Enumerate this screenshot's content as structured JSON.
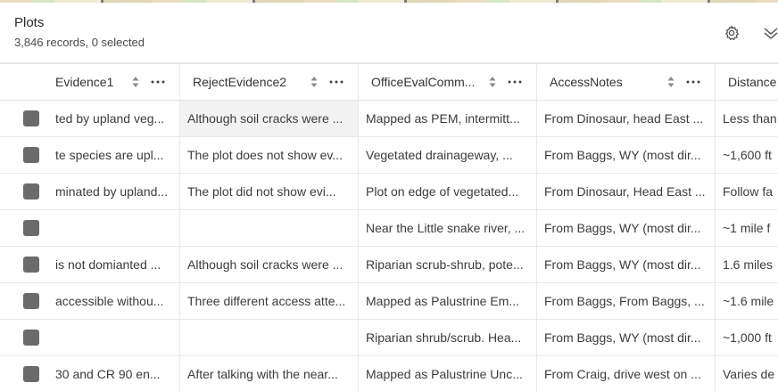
{
  "layer": {
    "title": "Plots",
    "record_summary": "3,846 records, 0 selected"
  },
  "toolbar": {
    "settings_icon": "gear-icon",
    "collapse_icon": "chevrons-down-icon"
  },
  "columns": [
    {
      "label": "Evidence1"
    },
    {
      "label": "RejectEvidence2"
    },
    {
      "label": "OfficeEvalComm..."
    },
    {
      "label": "AccessNotes"
    },
    {
      "label": "Distance"
    }
  ],
  "rows": [
    [
      "ted by upland veg...",
      "Although soil cracks were ...",
      "Mapped as PEM, intermitt...",
      "From Dinosaur, head East ...",
      "Less than"
    ],
    [
      "te species are upl...",
      "The plot does not show ev...",
      "Vegetated drainageway, ...",
      "From Baggs, WY (most dir...",
      "~1,600 ft"
    ],
    [
      "minated by upland...",
      "The plot did not show evi...",
      "Plot on edge of vegetated...",
      "From Dinosaur, Head East ...",
      "Follow fa"
    ],
    [
      "",
      "",
      "Near the Little snake river, ...",
      "From Baggs, WY (most dir...",
      "~1 mile f"
    ],
    [
      "is not domianted ...",
      "Although soil cracks were ...",
      "Riparian scrub-shrub, pote...",
      "From Baggs, WY (most dir...",
      "1.6 miles"
    ],
    [
      "accessible withou...",
      "Three different access atte...",
      "Mapped as Palustrine Em...",
      "From Baggs, From Baggs, ...",
      "~1.6 mile"
    ],
    [
      "",
      "",
      "Riparian shrub/scrub. Hea...",
      "From Baggs, WY (most dir...",
      "~1,000 ft"
    ],
    [
      "30 and CR 90 en...",
      "After talking with the near...",
      "Mapped as Palustrine Unc...",
      "From Craig, drive west on ...",
      "Varies de"
    ]
  ]
}
